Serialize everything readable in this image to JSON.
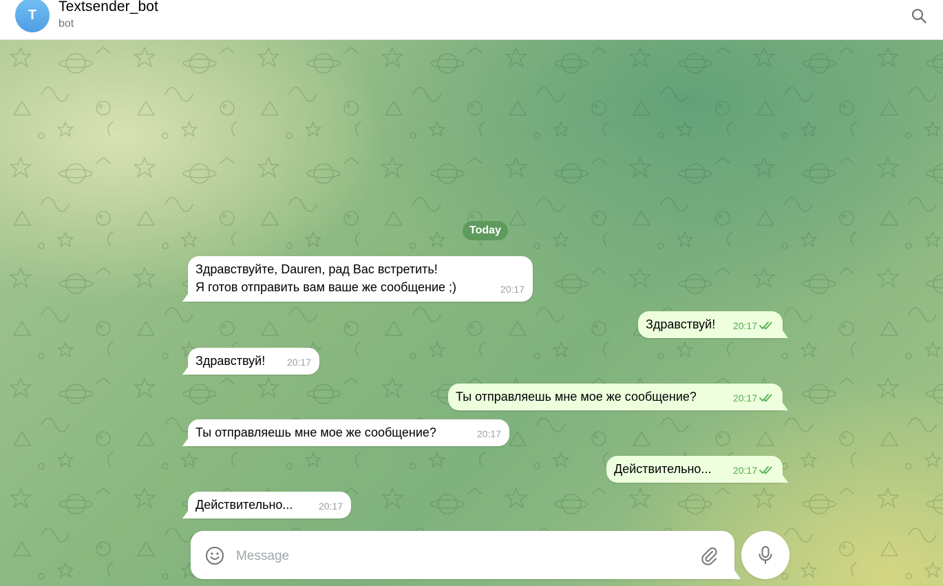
{
  "header": {
    "avatar_letter": "T",
    "title": "Textsender_bot",
    "subtitle": "bot",
    "search_icon": "search-icon"
  },
  "chat": {
    "date_label": "Today",
    "messages": [
      {
        "direction": "in",
        "text": "Здравствуйте, Dauren, рад Вас встретить!\nЯ готов отправить вам ваше же сообщение ;)",
        "time": "20:17"
      },
      {
        "direction": "out",
        "text": "Здравствуй!",
        "time": "20:17",
        "status": "read"
      },
      {
        "direction": "in",
        "text": "Здравствуй!",
        "time": "20:17"
      },
      {
        "direction": "out",
        "text": "Ты отправляешь мне мое же сообщение?",
        "time": "20:17",
        "status": "read"
      },
      {
        "direction": "in",
        "text": "Ты отправляешь мне мое же сообщение?",
        "time": "20:17"
      },
      {
        "direction": "out",
        "text": "Действительно...",
        "time": "20:17",
        "status": "read"
      },
      {
        "direction": "in",
        "text": "Действительно...",
        "time": "20:17"
      }
    ]
  },
  "composer": {
    "placeholder": "Message",
    "value": "",
    "emoji_icon": "smile-icon",
    "attach_icon": "paperclip-icon",
    "mic_icon": "microphone-icon"
  },
  "colors": {
    "incoming_bubble": "#ffffff",
    "outgoing_bubble": "#eeffde",
    "read_check": "#4fae4e",
    "date_pill": "#5e9a5c"
  }
}
